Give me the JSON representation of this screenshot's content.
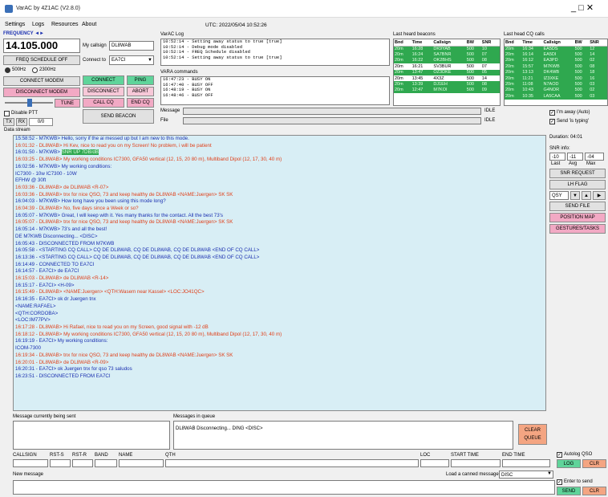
{
  "window": {
    "title": "VarAC by 4Z1AC (V2.8.0)",
    "controls": "_   □   ✕"
  },
  "menu": [
    "Settings",
    "Logs",
    "Resources",
    "About"
  ],
  "utc": "UTC: 2022/05/04 10:52:26",
  "frequency": {
    "label": "FREQUENCY ◄►",
    "value": "14.105.000",
    "schedule_btn": "FREQ SCHEDULE OFF",
    "bw_500": "500Hz",
    "bw_2300": "2300Hz",
    "connect_modem": "CONNECT MODEM",
    "disconnect_modem": "DISCONNECT MODEM",
    "tune": "TUNE",
    "disable_ptt": "Disable PTT",
    "tx": "TX",
    "rx": "RX",
    "counter": "0/0",
    "data_stream_label": "Data stream"
  },
  "call": {
    "my_callsign_label": "My callsign",
    "my_callsign": "DL8WAB",
    "connect_to_label": "Connect to",
    "connect_to": "EA7CI",
    "connect": "CONNECT",
    "ping": "PING",
    "disconnect": "DISCONNECT",
    "abort": "ABORT",
    "call_cq": "CALL CQ",
    "end_cq": "END CQ",
    "send_beacon": "SEND BEACON"
  },
  "varac_log": {
    "title": "VarAC Log",
    "lines": [
      "10:52:14 - Setting away status to true [true]",
      "10:52:14 - Debug mode disabled",
      "10:52:14 - FREQ Schedule disabled",
      "10:52:14 - Setting away status to true [true]"
    ]
  },
  "vara_commands": {
    "title": "VARA commands",
    "lines": [
      "16:47:23 - BUSY ON",
      "16:47:40 - BUSY OFF",
      "16:48:19 - BUSY ON",
      "16:48:46 - BUSY OFF"
    ]
  },
  "message_label": "Message",
  "file_label": "File",
  "idle1": "IDLE",
  "idle2": "IDLE",
  "last_heard_beacons": {
    "title": "Last heard beacons",
    "headers": [
      "Bnd",
      "Time",
      "Callsign",
      "BW",
      "SNR"
    ],
    "rows": [
      [
        "20m",
        "16:28",
        "DK9YAB",
        "500",
        "10"
      ],
      [
        "20m",
        "16:24",
        "SA7BNR",
        "500",
        "07"
      ],
      [
        "20m",
        "16:22",
        "OK2BHS",
        "500",
        "08"
      ],
      [
        "20m",
        "16:21",
        "SV3BUR",
        "500",
        "07"
      ],
      [
        "20m",
        "13:47",
        "OZ3DKE",
        "500",
        "05"
      ],
      [
        "20m",
        "13:45",
        "4X3Z",
        "500",
        "14"
      ],
      [
        "20m",
        "13:39",
        "DJ1EH",
        "500",
        "08"
      ],
      [
        "20m",
        "12:47",
        "M7KOI",
        "500",
        "09"
      ]
    ],
    "green": [
      true,
      true,
      true,
      false,
      true,
      false,
      true,
      true
    ]
  },
  "last_heard_cq": {
    "title": "Last head CQ calls",
    "headers": [
      "Bnd",
      "Time",
      "Callsign",
      "BW",
      "SNR"
    ],
    "rows": [
      [
        "20m",
        "16:34",
        "EA5DS",
        "500",
        "12"
      ],
      [
        "20m",
        "16:14",
        "EA5DI",
        "500",
        "14"
      ],
      [
        "20m",
        "16:12",
        "EA3PD",
        "500",
        "02"
      ],
      [
        "20m",
        "15:57",
        "M7KWB",
        "500",
        "08"
      ],
      [
        "20m",
        "13:13",
        "DK4WB",
        "500",
        "18"
      ],
      [
        "20m",
        "11:21",
        "IZ3XKE",
        "500",
        "16"
      ],
      [
        "20m",
        "11:08",
        "N7AOD",
        "500",
        "03"
      ],
      [
        "20m",
        "10:43",
        "G4NOR",
        "500",
        "02"
      ],
      [
        "20m",
        "10:35",
        "LA5CAA",
        "500",
        "03"
      ]
    ]
  },
  "right_panel": {
    "im_away": "I'm away (Auto)",
    "send_typing": "Send 'is typing'",
    "duration": "Duration: 04:01",
    "snr_info": "SNR info:",
    "snr_vals": [
      "-10",
      "-11",
      "-04"
    ],
    "snr_hdr": [
      "Last",
      "Avg",
      "Max"
    ],
    "snr_request": "SNR REQUEST",
    "lh_flag": "LH FLAG",
    "qsy_label": "QSY",
    "send_file": "SEND FILE",
    "position_map": "POSITION MAP",
    "gestures": "GESTURES/TASKS"
  },
  "stream": [
    {
      "c": "blue",
      "t": "15:58:52 - M7KWB> Hello, sorry if the ai messed up but I am new to this mode."
    },
    {
      "c": "red",
      "t": "16:01:32 - DL8WAB> Hi Kev, nice to read you on my Screen! No problem, i will be patient"
    },
    {
      "c": "blue",
      "t": "16:01:50 - M7KWB> ",
      "h": "SNR UP 7DB/dB"
    },
    {
      "c": "red",
      "t": "16:03:25 - DL8WAB> My working conditions IC7300, GFA50 vertical (12, 15, 20 80 m), Multiband Dipol (12, 17, 30, 40 m)"
    },
    {
      "c": "blue",
      "t": "16:02:56 - M7KWB> My working conditions:"
    },
    {
      "c": "blue",
      "t": "IC7300 - 10w IC7300 - 10W"
    },
    {
      "c": "blue",
      "t": "EFHW @ 30ft"
    },
    {
      "c": "red",
      "t": "16:03:36 - DL8WAB> de DL8WAB <R-07>"
    },
    {
      "c": "red",
      "t": "16:03:36 - DL8WAB> tnx for nice QSO, 73 and keep healthy de DL8WAB <NAME:Juergen> SK SK"
    },
    {
      "c": "blue",
      "t": "16:04:03 - M7KWB> How long have you been using this mode long?"
    },
    {
      "c": "red",
      "t": "16:04:39 - DL8WAB> No, five days since a Week or so?"
    },
    {
      "c": "blue",
      "t": "16:05:07 - M7KWB> Great, I will keep with it. Yes many thanks for the contact. All the best 73's"
    },
    {
      "c": "red",
      "t": "16:05:07 - DL8WAB> tnx for nice QSO, 73 and keep healthy de DL8WAB <NAME:Juergen> SK SK"
    },
    {
      "c": "blue",
      "t": "16:05:14 - M7KWB> 73's and all the best!"
    },
    {
      "c": "blue",
      "t": "DE M7KWB Disconnecting... <DISC>"
    },
    {
      "c": "blue",
      "t": "16:05:43 - DISCONNECTED FROM M7KWB"
    },
    {
      "c": "blue",
      "t": "16:05:58 - <STARTING CQ CALL> CQ DE DL8WAB, CQ DE DL8WAB, CQ DE DL8WAB <END OF CQ CALL>"
    },
    {
      "c": "blue",
      "t": "16:13:36 - <STARTING CQ CALL> CQ DE DL8WAB, CQ DE DL8WAB, CQ DE DL8WAB <END OF CQ CALL>"
    },
    {
      "c": "blue",
      "t": "16:14:49 - CONNECTED TO EA7CI"
    },
    {
      "c": "blue",
      "t": "16:14:57 - EA7CI> de EA7CI"
    },
    {
      "c": "red",
      "t": "16:15:03 - DL8WAB> de DL8WAB <R-14>"
    },
    {
      "c": "blue",
      "t": "16:15:17 - EA7CI> <H-09>"
    },
    {
      "c": "red",
      "t": "16:15:49 - DL8WAB> <NAME:Juergen> <QTH:Wasem near Kassel> <LOC:JO41QC>"
    },
    {
      "c": "blue",
      "t": "16:16:35 - EA7CI> ok dr Juergen tnx"
    },
    {
      "c": "blue",
      "t": "<NAME:RAFAEL>"
    },
    {
      "c": "blue",
      "t": "<QTH:CORDOBA>"
    },
    {
      "c": "blue",
      "t": "<LOC:IM77PV>"
    },
    {
      "c": "red",
      "t": "16:17:28 - DL8WAB> Hi Rafael, nice to read you on my Screen, good signal with -12 dB"
    },
    {
      "c": "red",
      "t": "16:18:12 - DL8WAB> My working conditions IC7300, GFA50 vertical (12, 15, 20 80 m), Multiband Dipol (12, 17, 30, 40 m)"
    },
    {
      "c": "blue",
      "t": "16:19:19 - EA7CI> My working conditions:"
    },
    {
      "c": "blue",
      "t": "ICOM-7300"
    },
    {
      "c": "red",
      "t": "16:19:34 - DL8WAB> tnx for nice QSO, 73 and keep healthy de DL8WAB <NAME:Juergen> SK SK"
    },
    {
      "c": "red",
      "t": "16:20:01 - DL8WAB> de DL8WAB <R-09>"
    },
    {
      "c": "blue",
      "t": "16:20:31 - EA7CI> ok Juergen tnx for qso 73 saludos"
    },
    {
      "c": "blue",
      "t": "16:23:51 - DISCONNECTED FROM EA7CI"
    }
  ],
  "bottom": {
    "msg_sent_label": "Message currently being sent",
    "msg_queue_label": "Messages in queue",
    "queue_text": "DL8WAB Disconnecting... DING <DISC>",
    "clear_queue": "CLEAR QUEUE",
    "fields": [
      "CALLSIGN",
      "RST-S",
      "RST-R",
      "BAND",
      "NAME",
      "QTH",
      "LOC",
      "START TIME",
      "END TIME"
    ],
    "autolog": "Autolog QSO",
    "log": "LOG",
    "clr": "CLR",
    "new_message": "New message",
    "load_canned": "Load a canned message",
    "canned_value": "DISC",
    "enter_to_send": "Enter to send",
    "send": "SEND",
    "clr2": "CLR"
  }
}
